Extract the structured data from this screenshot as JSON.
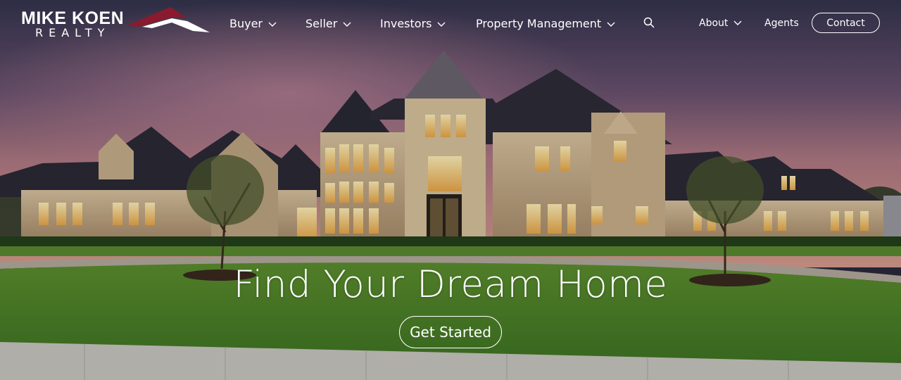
{
  "brand": {
    "name_top": "MIKE KOEN",
    "name_bottom": "REALTY",
    "roof_colors": {
      "dark": "#8a1a2e",
      "light": "#ffffff"
    }
  },
  "nav": {
    "primary": [
      {
        "label": "Buyer",
        "has_dropdown": true
      },
      {
        "label": "Seller",
        "has_dropdown": true
      },
      {
        "label": "Investors",
        "has_dropdown": true
      },
      {
        "label": "Property Management",
        "has_dropdown": true
      }
    ],
    "search_icon": "search-icon",
    "secondary": [
      {
        "label": "About",
        "has_dropdown": true
      },
      {
        "label": "Agents",
        "has_dropdown": false
      }
    ],
    "contact_label": "Contact"
  },
  "hero": {
    "headline": "Find Your Dream Home",
    "cta_label": "Get Started",
    "colors": {
      "sky_top": "#3c3a55",
      "sky_glow": "#c98a8f",
      "lawn": "#4f8a2a",
      "window_light": "#ffd98a"
    }
  }
}
